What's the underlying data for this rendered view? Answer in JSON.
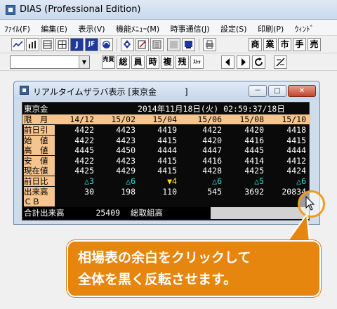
{
  "app": {
    "title": "DIAS (Professional Edition)"
  },
  "menu": [
    {
      "label": "ﾌｧｲﾙ(F)"
    },
    {
      "label": "編集(E)"
    },
    {
      "label": "表示(V)"
    },
    {
      "label": "機能ﾒﾆｭｰ(M)"
    },
    {
      "label": "時事通信(J)"
    },
    {
      "label": "設定(S)"
    },
    {
      "label": "印刷(P)"
    },
    {
      "label": "ｳｨﾝﾄﾞ"
    }
  ],
  "toolbar1": {
    "icons": [
      "line-chart-icon",
      "bar-chart-icon",
      "table-icon",
      "grid-table-icon",
      "j-icon",
      "jf-icon",
      "swirl-icon",
      "pin-icon",
      "order-icon",
      "list-icon",
      "rewind-icon",
      "stop-icon",
      "printer-icon"
    ],
    "text_buttons": [
      "商",
      "業",
      "市",
      "手",
      "売"
    ],
    "glyph_labels": [
      "J",
      "JF"
    ]
  },
  "toolbar2": {
    "symbol_value": "",
    "buttons": [
      "売買",
      "総",
      "員",
      "時",
      "複",
      "残",
      "ｽﾄｯﾌﾟ"
    ],
    "nav": [
      "previous-icon",
      "next-icon",
      "refresh-icon",
      "settings-icon"
    ]
  },
  "child_window": {
    "title": "リアルタイムザラバ表示 [東京金",
    "title_tail": "]",
    "min_label": "－",
    "max_label": "□",
    "close_label": "✕"
  },
  "board": {
    "market": "東京金",
    "datetime": "2014年11月18日(火) 02:59:37/18日",
    "header_label": "限　月",
    "months": [
      "14/12",
      "15/02",
      "15/04",
      "15/06",
      "15/08",
      "15/10"
    ],
    "rows": [
      {
        "label": "前日引",
        "values": [
          "4422",
          "4423",
          "4419",
          "4422",
          "4420",
          "4418"
        ],
        "style": "plain"
      },
      {
        "label": "始　値",
        "values": [
          "4422",
          "4423",
          "4415",
          "4420",
          "4416",
          "4415"
        ],
        "style": "plain"
      },
      {
        "label": "高　値",
        "values": [
          "4445",
          "4450",
          "4444",
          "4447",
          "4445",
          "4444"
        ],
        "style": "plain"
      },
      {
        "label": "安　値",
        "values": [
          "4422",
          "4423",
          "4415",
          "4416",
          "4414",
          "4412"
        ],
        "style": "plain"
      },
      {
        "label": "現在値",
        "values": [
          "4425",
          "4429",
          "4415",
          "4428",
          "4425",
          "4424"
        ],
        "style": "plain"
      },
      {
        "label": "前日比",
        "values": [
          "△3",
          "△6",
          "▼4",
          "△6",
          "△5",
          "△6"
        ],
        "colors": [
          "#3ed9e8",
          "#3ed9e8",
          "#ffe000",
          "#3ed9e8",
          "#3ed9e8",
          "#3ed9e8"
        ]
      },
      {
        "label": "出来高",
        "values": [
          "30",
          "198",
          "110",
          "545",
          "3692",
          "20834"
        ],
        "style": "plain"
      },
      {
        "label": "ＣＢ",
        "values": [
          "",
          "",
          "",
          "",
          "",
          ""
        ],
        "style": "plain"
      }
    ],
    "total_label": "合計出来高",
    "total_value": "25409",
    "total_suffix": "総取組高"
  },
  "callout": {
    "line1": "相場表の余白をクリックして",
    "line2": "全体を黒く反転させます。"
  },
  "colors": {
    "header_bg": "#f6c48e",
    "up": "#3ed9e8",
    "down": "#ffe000",
    "callout": "#e6860f",
    "highlight_ring": "#f29a1c"
  }
}
